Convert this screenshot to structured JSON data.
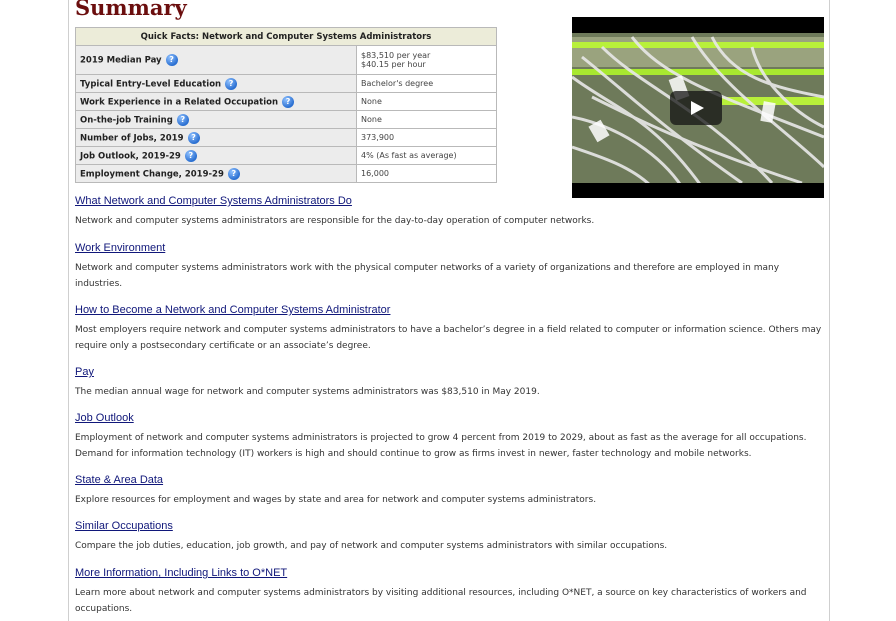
{
  "page": {
    "title": "Summary"
  },
  "quick_facts": {
    "header": "Quick Facts: Network and Computer Systems Administrators",
    "rows": [
      {
        "label": "2019 Median Pay",
        "value": "$83,510 per year",
        "value2": "$40.15 per hour"
      },
      {
        "label": "Typical Entry-Level Education",
        "value": "Bachelor's degree"
      },
      {
        "label": "Work Experience in a Related Occupation",
        "value": "None"
      },
      {
        "label": "On-the-job Training",
        "value": "None"
      },
      {
        "label": "Number of Jobs, 2019",
        "value": "373,900"
      },
      {
        "label": "Job Outlook, 2019-29",
        "value": "4% (As fast as average)"
      },
      {
        "label": "Employment Change, 2019-29",
        "value": "16,000"
      }
    ],
    "help_glyph": "?"
  },
  "sections": [
    {
      "link": "What Network and Computer Systems Administrators Do",
      "text": "Network and computer systems administrators are responsible for the day-to-day operation of computer networks."
    },
    {
      "link": "Work Environment",
      "text": "Network and computer systems administrators work with the physical computer networks of a variety of organizations and therefore are employed in many industries."
    },
    {
      "link": "How to Become a Network and Computer Systems Administrator",
      "text": "Most employers require network and computer systems administrators to have a bachelor’s degree in a field related to computer or information science. Others may require only a postsecondary certificate or an associate’s degree."
    },
    {
      "link": "Pay",
      "text": "The median annual wage for network and computer systems administrators was $83,510 in May 2019."
    },
    {
      "link": "Job Outlook",
      "text": "Employment of network and computer systems administrators is projected to grow 4 percent from 2019 to 2029, about as fast as the average for all occupations. Demand for information technology (IT) workers is high and should continue to grow as firms invest in newer, faster technology and mobile networks."
    },
    {
      "link": "State & Area Data",
      "text": "Explore resources for employment and wages by state and area for network and computer systems administrators."
    },
    {
      "link": "Similar Occupations",
      "text": "Compare the job duties, education, job growth, and pay of network and computer systems administrators with similar occupations."
    },
    {
      "link": "More Information, Including Links to O*NET",
      "text": "Learn more about network and computer systems administrators by visiting additional resources, including O*NET, a source on key characteristics of workers and occupations."
    }
  ],
  "icons": {
    "help": "help-question-icon",
    "play": "play-icon"
  },
  "colors": {
    "title": "#6b0e0e",
    "link": "#10177a",
    "table_header": "#ececd9"
  }
}
